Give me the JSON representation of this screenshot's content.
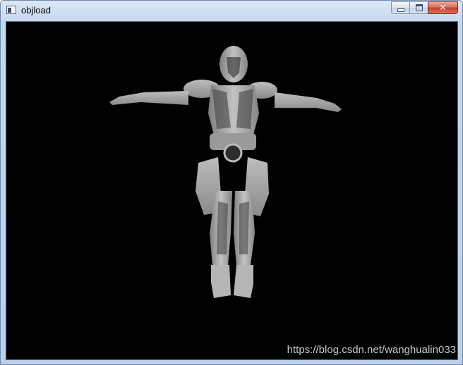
{
  "window": {
    "title": "objload",
    "app_icon": "console-window-icon"
  },
  "caption_buttons": {
    "minimize_icon": "minimize-icon",
    "maximize_icon": "maximize-icon",
    "close_glyph": "✕",
    "close_icon": "close-icon"
  },
  "viewport": {
    "background": "#000000",
    "model_color": "#a9a9a9",
    "watermark": "https://blog.csdn.net/wanghualin033"
  }
}
